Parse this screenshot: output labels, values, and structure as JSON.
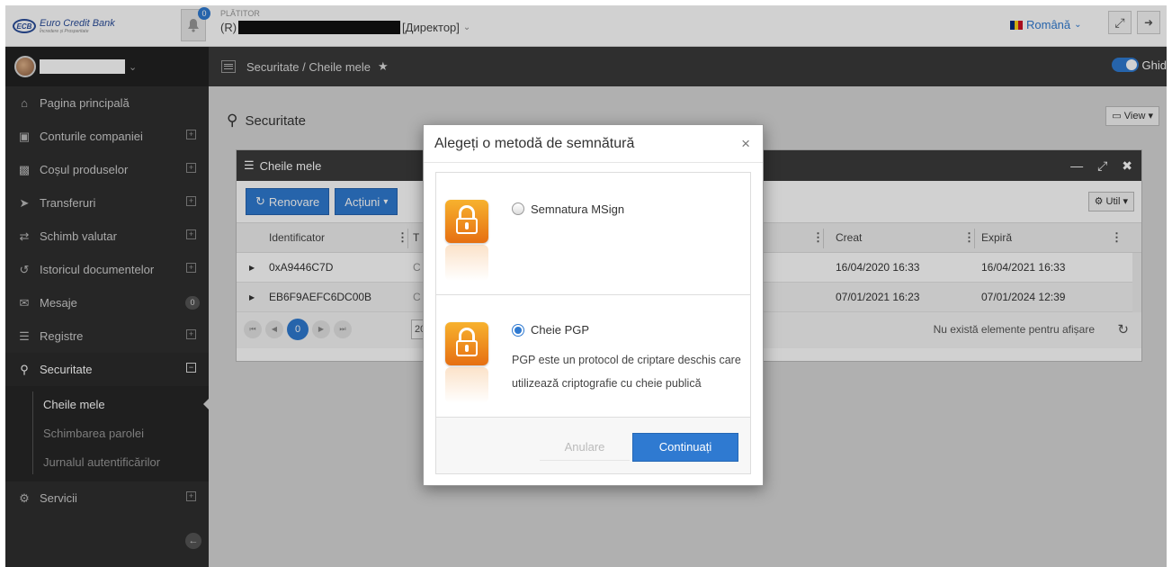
{
  "header": {
    "bank_name": "Euro Credit Bank",
    "bank_logo_mark": "ECB",
    "bank_tagline": "Încredere și Prosperitate",
    "notification_count": "0",
    "payer_label": "PLĂTITOR",
    "payer_prefix": "(R)",
    "payer_role": "[Директор]",
    "language": "Română",
    "icons": [
      "bell-icon",
      "fullscreen-icon",
      "logout-icon"
    ]
  },
  "sidebar": {
    "items": [
      {
        "label": "Pagina principală",
        "icon": "home-icon"
      },
      {
        "label": "Conturile companiei",
        "icon": "wallet-icon"
      },
      {
        "label": "Coșul produselor",
        "icon": "briefcase-icon"
      },
      {
        "label": "Transferuri",
        "icon": "send-icon"
      },
      {
        "label": "Schimb valutar",
        "icon": "exchange-icon"
      },
      {
        "label": "Istoricul documentelor",
        "icon": "history-icon"
      },
      {
        "label": "Mesaje",
        "icon": "inbox-icon",
        "badge": "0"
      },
      {
        "label": "Registre",
        "icon": "list-icon"
      },
      {
        "label": "Securitate",
        "icon": "key-icon"
      },
      {
        "label": "Servicii",
        "icon": "cogs-icon"
      }
    ],
    "sub_items": [
      "Cheile mele",
      "Schimbarea parolei",
      "Jurnalul autentificărilor"
    ]
  },
  "breadcrumb": {
    "text": "Securitate / Cheile mele",
    "guide_label": "Ghid"
  },
  "page": {
    "title": "Securitate",
    "view_label": "View"
  },
  "panel": {
    "title": "Cheile mele",
    "renew_label": "Renovare",
    "actions_label": "Acțiuni",
    "util_label": "Util",
    "columns": {
      "identifier": "Identificator",
      "type": "T",
      "created": "Creat",
      "expires": "Expiră"
    },
    "rows": [
      {
        "id": "0xA9446C7D",
        "type": "C",
        "created": "16/04/2020 16:33",
        "expires": "16/04/2021 16:33"
      },
      {
        "id": "EB6F9AEFC6DC00B",
        "type": "C",
        "created": "07/01/2021 16:23",
        "expires": "07/01/2024 12:39"
      }
    ],
    "pager": {
      "page": "0",
      "page_size": "20",
      "empty_text": "Nu există elemente pentru afișare"
    }
  },
  "modal": {
    "title": "Alegeți o metodă de semnătură",
    "options": [
      {
        "label": "Semnatura MSign",
        "selected": false
      },
      {
        "label": "Cheie PGP",
        "selected": true,
        "description": "PGP este un protocol de criptare deschis care utilizează criptografie cu cheie publică"
      }
    ],
    "cancel_label": "Anulare",
    "continue_label": "Continuați"
  },
  "colors": {
    "accent": "#2f7ad1",
    "sidebar": "#2f2f2f",
    "lock_orange": "#f39420"
  }
}
